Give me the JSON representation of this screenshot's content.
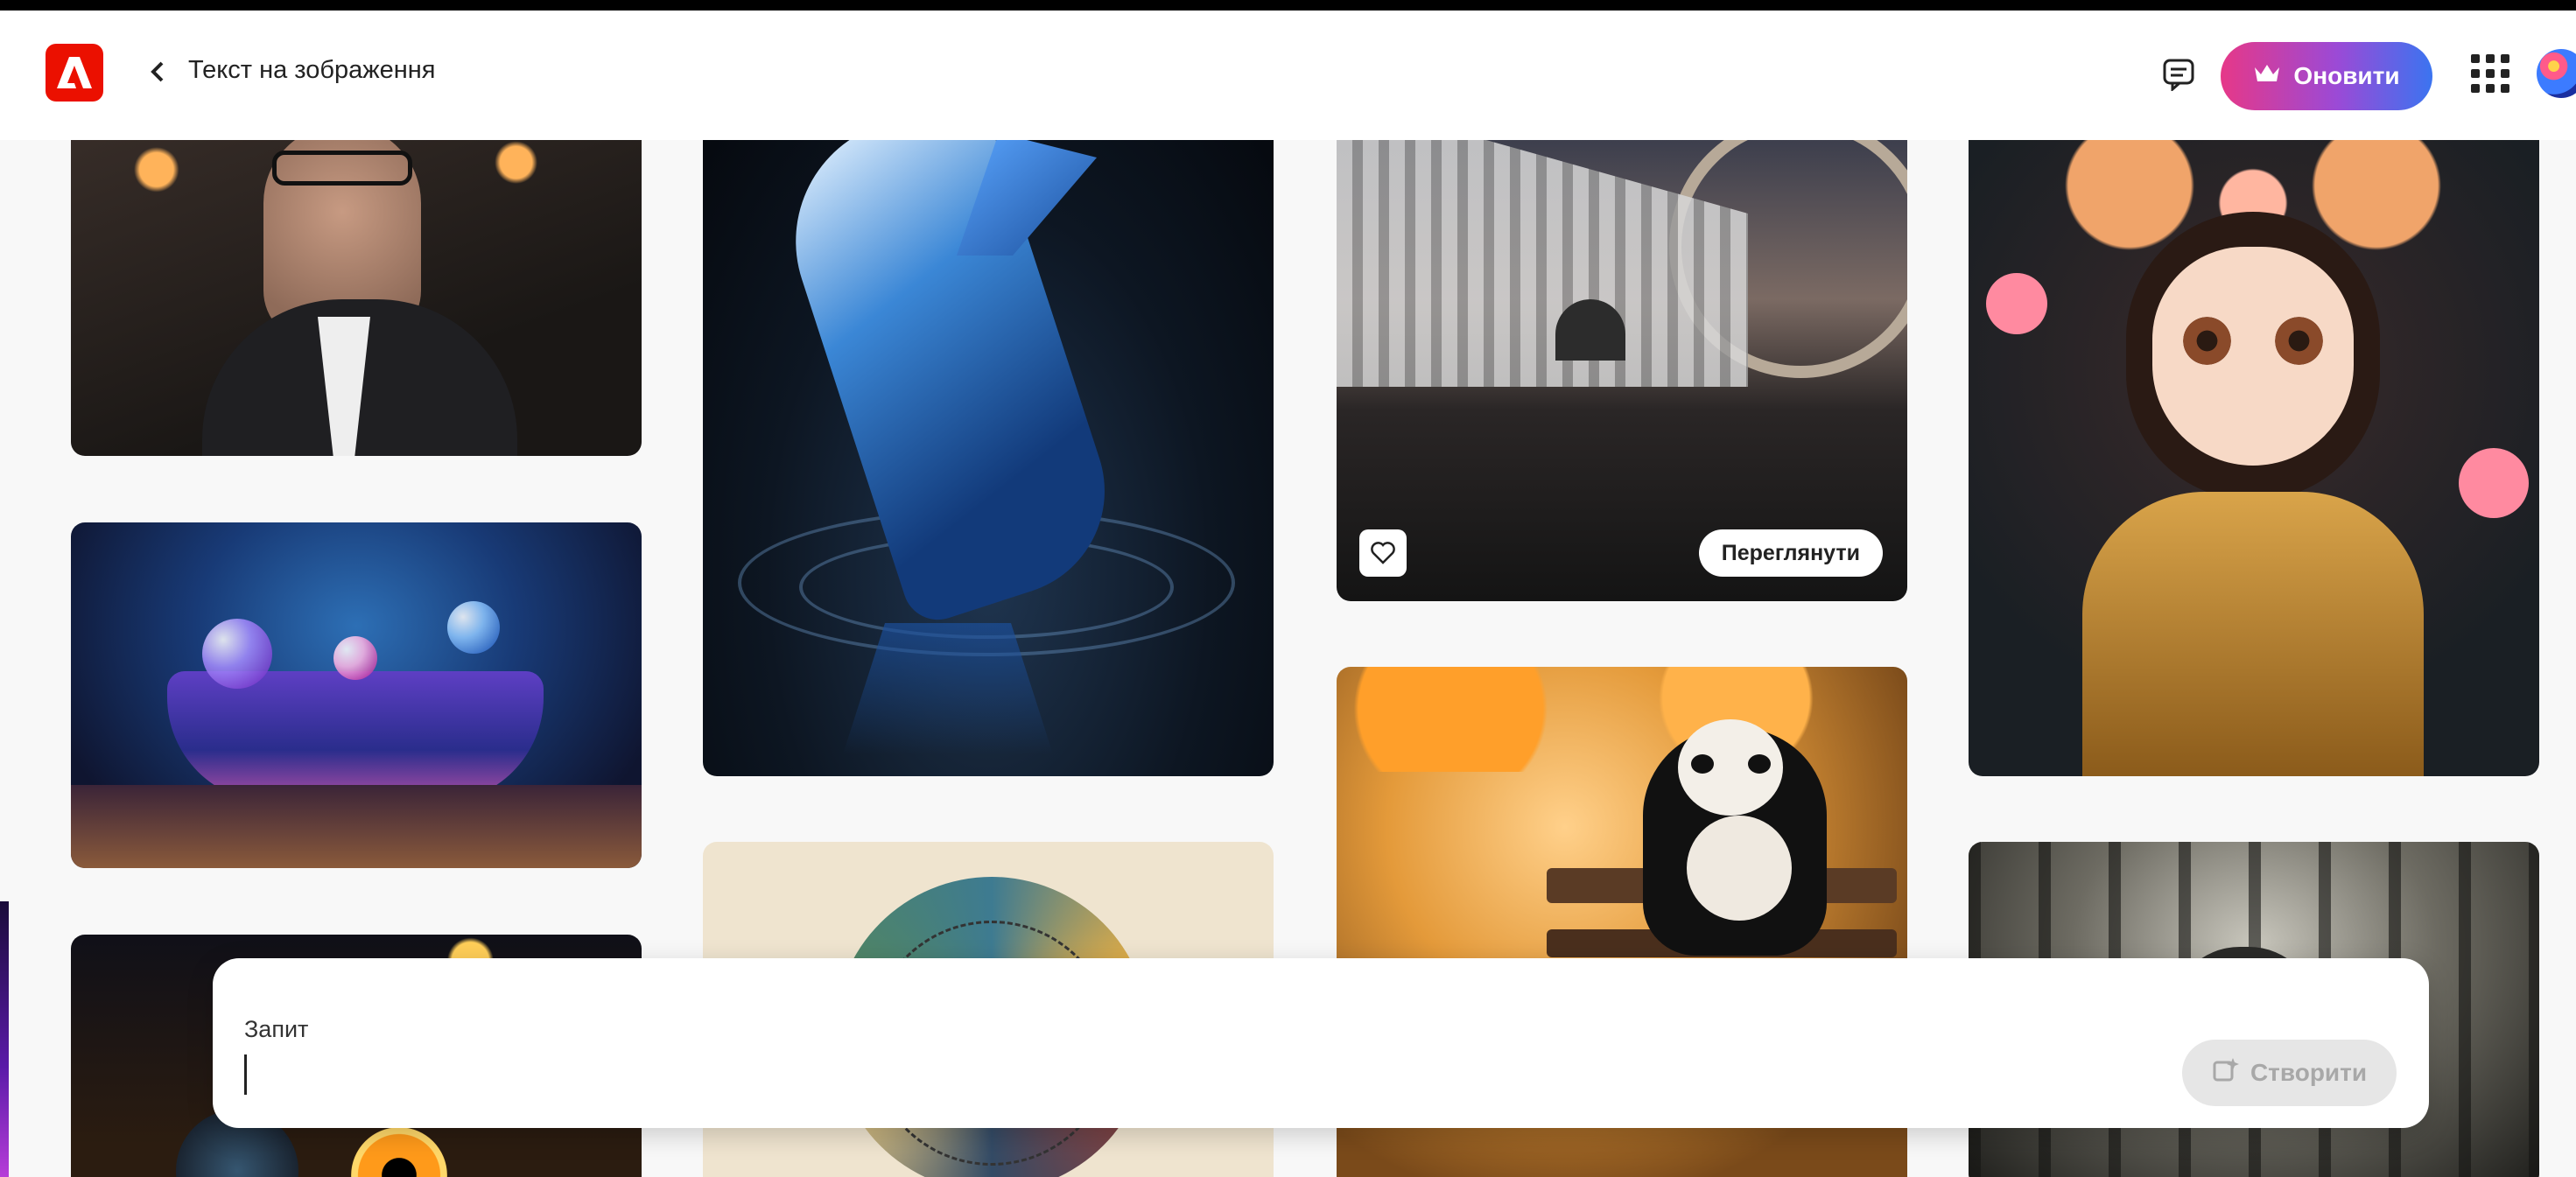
{
  "header": {
    "title": "Текст на зображення",
    "upgrade_label": "Оновити"
  },
  "gallery": {
    "view_label": "Переглянути",
    "cards": [
      {
        "name": "man-with-glasses"
      },
      {
        "name": "cosmic-bathtub"
      },
      {
        "name": "owl-eyes"
      },
      {
        "name": "blue-marlin-splash"
      },
      {
        "name": "geometric-sphere"
      },
      {
        "name": "futuristic-arch"
      },
      {
        "name": "panda-on-bench"
      },
      {
        "name": "floral-anime-girl"
      },
      {
        "name": "misty-forest-horse"
      }
    ]
  },
  "prompt": {
    "label": "Запит",
    "input_value": "",
    "create_label": "Створити"
  },
  "colors": {
    "adobe_red": "#eb1000",
    "upgrade_gradient_start": "#e63888",
    "upgrade_gradient_end": "#3b74f0",
    "disabled_button_bg": "#e6e6e6"
  },
  "icons": [
    "adobe-logo-icon",
    "chevron-left-icon",
    "feedback-icon",
    "crown-icon",
    "app-grid-icon",
    "heart-icon",
    "sparkle-create-icon"
  ]
}
